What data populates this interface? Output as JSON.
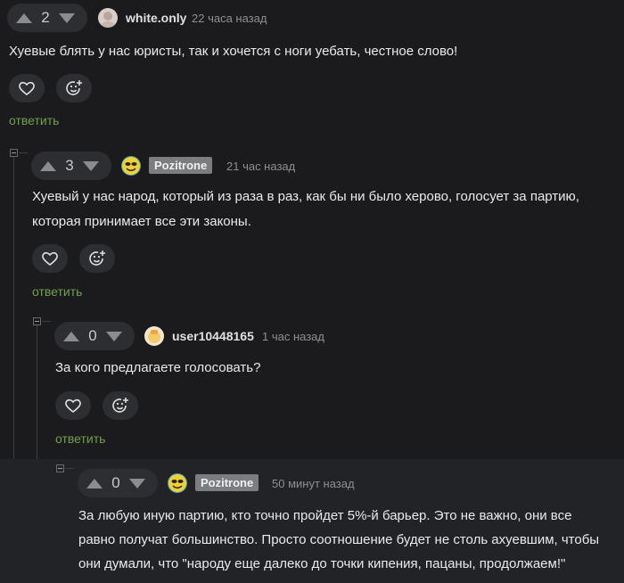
{
  "comments": [
    {
      "votes": "2",
      "author": "white.only",
      "time": "22 часа назад",
      "text": "Хуевые блять у нас юристы, так и хочется с ноги уебать, честное слово!",
      "reply": "ответить"
    },
    {
      "votes": "3",
      "author": "Pozitrone",
      "time": "21 час назад",
      "text_lines": [
        "Хуевый у нас народ, который из раза в раз, как бы ни было херово, голосует за партию,",
        "которая принимает все эти законы."
      ],
      "reply": "ответить"
    },
    {
      "votes": "0",
      "author": "user10448165",
      "time": "1 час назад",
      "text": "За кого предлагаете голосовать?",
      "reply": "ответить"
    },
    {
      "votes": "0",
      "author": "Pozitrone",
      "time": "50 минут назад",
      "text_lines": [
        "За любую иную партию, кто точно пройдет 5%-й барьер. Это не важно, они все",
        "равно получат большинство. Просто соотношение будет не столь ахуевшим, чтобы",
        "они думали, что \"народу еще далеко до точки кипения, пацаны, продолжаем!\""
      ]
    }
  ],
  "colors": {
    "background": "#1b1b1d",
    "highlight_background": "#222326",
    "reply_link": "#6fa14b",
    "badge": "#7b7d80"
  }
}
